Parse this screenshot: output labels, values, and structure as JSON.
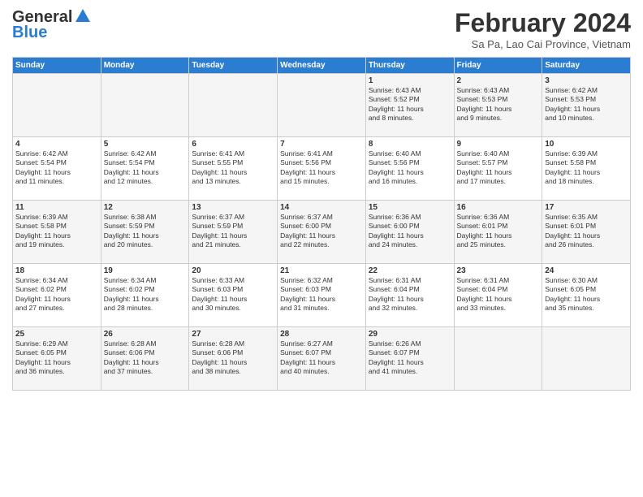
{
  "header": {
    "logo_general": "General",
    "logo_blue": "Blue",
    "month_title": "February 2024",
    "subtitle": "Sa Pa, Lao Cai Province, Vietnam"
  },
  "days_of_week": [
    "Sunday",
    "Monday",
    "Tuesday",
    "Wednesday",
    "Thursday",
    "Friday",
    "Saturday"
  ],
  "weeks": [
    [
      {
        "day": "",
        "info": ""
      },
      {
        "day": "",
        "info": ""
      },
      {
        "day": "",
        "info": ""
      },
      {
        "day": "",
        "info": ""
      },
      {
        "day": "1",
        "info": "Sunrise: 6:43 AM\nSunset: 5:52 PM\nDaylight: 11 hours\nand 8 minutes."
      },
      {
        "day": "2",
        "info": "Sunrise: 6:43 AM\nSunset: 5:53 PM\nDaylight: 11 hours\nand 9 minutes."
      },
      {
        "day": "3",
        "info": "Sunrise: 6:42 AM\nSunset: 5:53 PM\nDaylight: 11 hours\nand 10 minutes."
      }
    ],
    [
      {
        "day": "4",
        "info": "Sunrise: 6:42 AM\nSunset: 5:54 PM\nDaylight: 11 hours\nand 11 minutes."
      },
      {
        "day": "5",
        "info": "Sunrise: 6:42 AM\nSunset: 5:54 PM\nDaylight: 11 hours\nand 12 minutes."
      },
      {
        "day": "6",
        "info": "Sunrise: 6:41 AM\nSunset: 5:55 PM\nDaylight: 11 hours\nand 13 minutes."
      },
      {
        "day": "7",
        "info": "Sunrise: 6:41 AM\nSunset: 5:56 PM\nDaylight: 11 hours\nand 15 minutes."
      },
      {
        "day": "8",
        "info": "Sunrise: 6:40 AM\nSunset: 5:56 PM\nDaylight: 11 hours\nand 16 minutes."
      },
      {
        "day": "9",
        "info": "Sunrise: 6:40 AM\nSunset: 5:57 PM\nDaylight: 11 hours\nand 17 minutes."
      },
      {
        "day": "10",
        "info": "Sunrise: 6:39 AM\nSunset: 5:58 PM\nDaylight: 11 hours\nand 18 minutes."
      }
    ],
    [
      {
        "day": "11",
        "info": "Sunrise: 6:39 AM\nSunset: 5:58 PM\nDaylight: 11 hours\nand 19 minutes."
      },
      {
        "day": "12",
        "info": "Sunrise: 6:38 AM\nSunset: 5:59 PM\nDaylight: 11 hours\nand 20 minutes."
      },
      {
        "day": "13",
        "info": "Sunrise: 6:37 AM\nSunset: 5:59 PM\nDaylight: 11 hours\nand 21 minutes."
      },
      {
        "day": "14",
        "info": "Sunrise: 6:37 AM\nSunset: 6:00 PM\nDaylight: 11 hours\nand 22 minutes."
      },
      {
        "day": "15",
        "info": "Sunrise: 6:36 AM\nSunset: 6:00 PM\nDaylight: 11 hours\nand 24 minutes."
      },
      {
        "day": "16",
        "info": "Sunrise: 6:36 AM\nSunset: 6:01 PM\nDaylight: 11 hours\nand 25 minutes."
      },
      {
        "day": "17",
        "info": "Sunrise: 6:35 AM\nSunset: 6:01 PM\nDaylight: 11 hours\nand 26 minutes."
      }
    ],
    [
      {
        "day": "18",
        "info": "Sunrise: 6:34 AM\nSunset: 6:02 PM\nDaylight: 11 hours\nand 27 minutes."
      },
      {
        "day": "19",
        "info": "Sunrise: 6:34 AM\nSunset: 6:02 PM\nDaylight: 11 hours\nand 28 minutes."
      },
      {
        "day": "20",
        "info": "Sunrise: 6:33 AM\nSunset: 6:03 PM\nDaylight: 11 hours\nand 30 minutes."
      },
      {
        "day": "21",
        "info": "Sunrise: 6:32 AM\nSunset: 6:03 PM\nDaylight: 11 hours\nand 31 minutes."
      },
      {
        "day": "22",
        "info": "Sunrise: 6:31 AM\nSunset: 6:04 PM\nDaylight: 11 hours\nand 32 minutes."
      },
      {
        "day": "23",
        "info": "Sunrise: 6:31 AM\nSunset: 6:04 PM\nDaylight: 11 hours\nand 33 minutes."
      },
      {
        "day": "24",
        "info": "Sunrise: 6:30 AM\nSunset: 6:05 PM\nDaylight: 11 hours\nand 35 minutes."
      }
    ],
    [
      {
        "day": "25",
        "info": "Sunrise: 6:29 AM\nSunset: 6:05 PM\nDaylight: 11 hours\nand 36 minutes."
      },
      {
        "day": "26",
        "info": "Sunrise: 6:28 AM\nSunset: 6:06 PM\nDaylight: 11 hours\nand 37 minutes."
      },
      {
        "day": "27",
        "info": "Sunrise: 6:28 AM\nSunset: 6:06 PM\nDaylight: 11 hours\nand 38 minutes."
      },
      {
        "day": "28",
        "info": "Sunrise: 6:27 AM\nSunset: 6:07 PM\nDaylight: 11 hours\nand 40 minutes."
      },
      {
        "day": "29",
        "info": "Sunrise: 6:26 AM\nSunset: 6:07 PM\nDaylight: 11 hours\nand 41 minutes."
      },
      {
        "day": "",
        "info": ""
      },
      {
        "day": "",
        "info": ""
      }
    ]
  ]
}
